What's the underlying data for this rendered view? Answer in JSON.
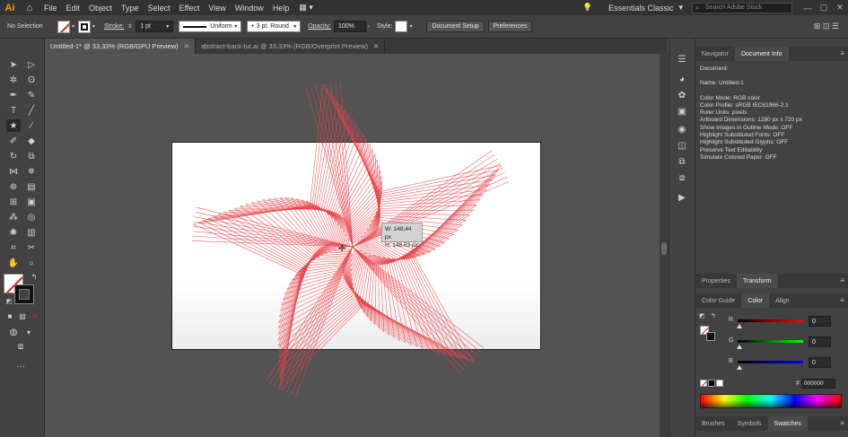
{
  "app": {
    "logo": "Ai",
    "home_icon": "home-icon"
  },
  "menu": [
    "File",
    "Edit",
    "Object",
    "Type",
    "Select",
    "Effect",
    "View",
    "Window",
    "Help"
  ],
  "workspace": "Essentials Classic",
  "search_placeholder": "Search Adobe Stock",
  "control": {
    "selection": "No Selection",
    "stroke_label": "Stroke:",
    "stroke_value": "1 pt",
    "profile": "Uniform",
    "brush": "3 pt. Round",
    "opacity_label": "Opacity:",
    "opacity_value": "100%",
    "style_label": "Style:",
    "doc_setup": "Document Setup",
    "preferences": "Preferences"
  },
  "tabs": [
    {
      "label": "Untitled-1* @ 33,33% (RGB/GPU Preview)",
      "active": true
    },
    {
      "label": "abstract-back-tut.ai @ 33,33% (RGB/Overprint Preview)",
      "active": false
    }
  ],
  "measure": {
    "w": "W: 148,44 px",
    "h": "H: 148,63 px"
  },
  "panel_tabs_top": [
    "Navigator",
    "Document Info"
  ],
  "doc_info": {
    "heading": "Document:",
    "name": "Name: Untitled-1",
    "lines": [
      "Color Mode: RGB color",
      "Color Profile: sRGB IEC61966-2.1",
      "Ruler Units: pixels",
      "Artboard Dimensions: 1280 px x 720 px",
      "Show Images in Outline Mode: OFF",
      "Highlight Substituted Fonts: OFF",
      "Highlight Substituted Glyphs: OFF",
      "Preserve Text Editability",
      "Simulate Colored Paper: OFF"
    ]
  },
  "panel_tabs_mid": [
    "Properties",
    "Transform"
  ],
  "panel_tabs_color": [
    "Color Guide",
    "Color",
    "Align"
  ],
  "color": {
    "r_label": "R",
    "r_value": "0",
    "g_label": "G",
    "g_value": "0",
    "b_label": "B",
    "b_value": "0",
    "hash": "#",
    "hex": "000000"
  },
  "panel_tabs_bottom": [
    "Brushes",
    "Symbols",
    "Swatches"
  ],
  "colors": {
    "star_stroke": "#e8434a",
    "accent_orange": "#ff9a00"
  }
}
